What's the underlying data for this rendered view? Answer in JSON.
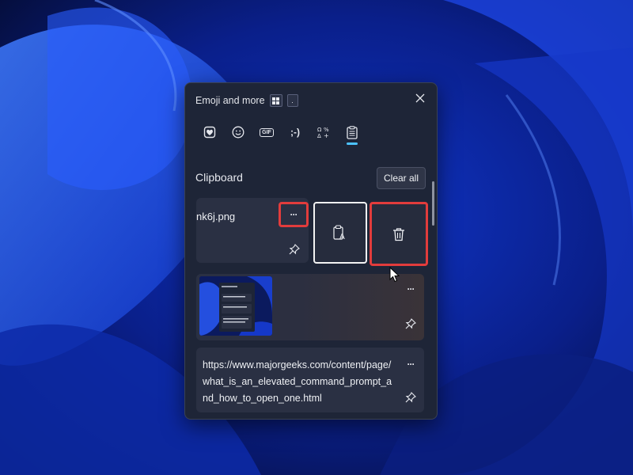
{
  "window": {
    "title": "Emoji and more",
    "shortcut_key": "."
  },
  "tabs": [
    {
      "icon": "heart-sticker-icon"
    },
    {
      "icon": "smiley-icon"
    },
    {
      "icon": "gif-icon",
      "label": "GIF"
    },
    {
      "icon": "kaomoji-icon",
      "label": ";-)"
    },
    {
      "icon": "symbols-icon"
    },
    {
      "icon": "clipboard-icon",
      "active": true
    }
  ],
  "clipboard": {
    "section_title": "Clipboard",
    "clear_all_label": "Clear all",
    "items": [
      {
        "text": "nk6j.png",
        "more_label": "···"
      },
      {
        "type": "image",
        "more_label": "···"
      },
      {
        "text": "https://www.majorgeeks.com/content/page/what_is_an_elevated_command_prompt_and_how_to_open_one.html",
        "more_label": "···"
      }
    ]
  },
  "colors": {
    "accent": "#4cc2ff",
    "highlight": "#e23c3c",
    "panel_bg": "#1e2537",
    "card_bg": "#2a3043"
  }
}
